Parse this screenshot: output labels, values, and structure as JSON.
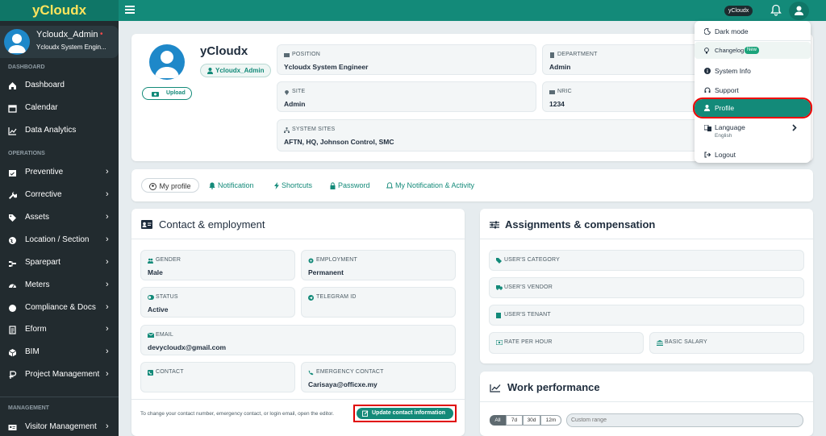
{
  "brand": "yCloudx",
  "topbar": {
    "chip": "yCloudx"
  },
  "sidebar": {
    "user_name": "Ycloudx_Admin",
    "user_dot": "•",
    "user_role": "Ycloudx System Engin...",
    "headings": [
      "DASHBOARD",
      "OPERATIONS",
      "MANAGEMENT"
    ],
    "items": [
      {
        "label": "Dashboard",
        "icon": "home-icon"
      },
      {
        "label": "Calendar",
        "icon": "calendar-icon"
      },
      {
        "label": "Data Analytics",
        "icon": "chart-icon"
      },
      {
        "label": "Preventive",
        "icon": "calendar-check-icon",
        "chevron": "›"
      },
      {
        "label": "Corrective",
        "icon": "wrench-icon",
        "chevron": "›"
      },
      {
        "label": "Assets",
        "icon": "tag-icon",
        "chevron": "›"
      },
      {
        "label": "Location / Section",
        "icon": "globe-icon",
        "chevron": "›"
      },
      {
        "label": "Sparepart",
        "icon": "sparepart-icon",
        "chevron": "›"
      },
      {
        "label": "Meters",
        "icon": "gauge-icon",
        "chevron": "›"
      },
      {
        "label": "Compliance & Docs",
        "icon": "certificate-icon",
        "chevron": "›"
      },
      {
        "label": "Eform",
        "icon": "form-icon",
        "chevron": "›"
      },
      {
        "label": "BIM",
        "icon": "cube-icon",
        "chevron": "›"
      },
      {
        "label": "Project Management",
        "icon": "project-icon",
        "chevron": "›"
      },
      {
        "label": "Visitor Management",
        "icon": "id-card-icon",
        "chevron": "›"
      }
    ]
  },
  "profile": {
    "name": "yCloudx",
    "username_badge": "Ycloudx_Admin",
    "upload": "Upload",
    "fields": {
      "position": {
        "label": "POSITION",
        "value": "Ycloudx System Engineer"
      },
      "department": {
        "label": "DEPARTMENT",
        "value": "Admin"
      },
      "site": {
        "label": "SITE",
        "value": "Admin"
      },
      "nric": {
        "label": "NRIC",
        "value": "1234"
      },
      "system_sites": {
        "label": "SYSTEM SITES",
        "value": "AFTN, HQ, Johnson Control, SMC"
      }
    }
  },
  "tabs": [
    "My profile",
    "Notification",
    "Shortcuts",
    "Password",
    "My Notification & Activity"
  ],
  "contact": {
    "title": "Contact & employment",
    "gender": {
      "label": "GENDER",
      "value": "Male"
    },
    "employment": {
      "label": "EMPLOYMENT",
      "value": "Permanent"
    },
    "status": {
      "label": "STATUS",
      "value": "Active"
    },
    "telegram": {
      "label": "TELEGRAM ID",
      "value": ""
    },
    "email": {
      "label": "EMAIL",
      "value": "devycloudx@gmail.com"
    },
    "contact": {
      "label": "CONTACT",
      "value": ""
    },
    "emergency": {
      "label": "EMERGENCY CONTACT",
      "value": "Carisaya@officxe.my"
    },
    "note": "To change your contact number, emergency contact, or login email, open the editor.",
    "button": "Update contact information"
  },
  "assign": {
    "title": "Assignments & compensation",
    "category": "USER'S CATEGORY",
    "vendor": "USER'S VENDOR",
    "tenant": "USER'S TENANT",
    "rate": "RATE PER HOUR",
    "salary": "BASIC SALARY"
  },
  "work": {
    "title": "Work performance",
    "ranges": [
      "All",
      "7d",
      "30d",
      "12m"
    ],
    "active_range": "All",
    "custom_placeholder": "Custom range"
  },
  "menu": {
    "dark_mode": "Dark mode",
    "changelog": "Changelog",
    "changelog_badge": "New",
    "system_info": "System Info",
    "support": "Support",
    "profile": "Profile",
    "language": "Language",
    "language_value": "English",
    "logout": "Logout"
  },
  "colors": {
    "accent": "#138a79",
    "sidebar": "#222b2f",
    "brand_text": "#ffe45c",
    "highlight": "#e00000"
  }
}
